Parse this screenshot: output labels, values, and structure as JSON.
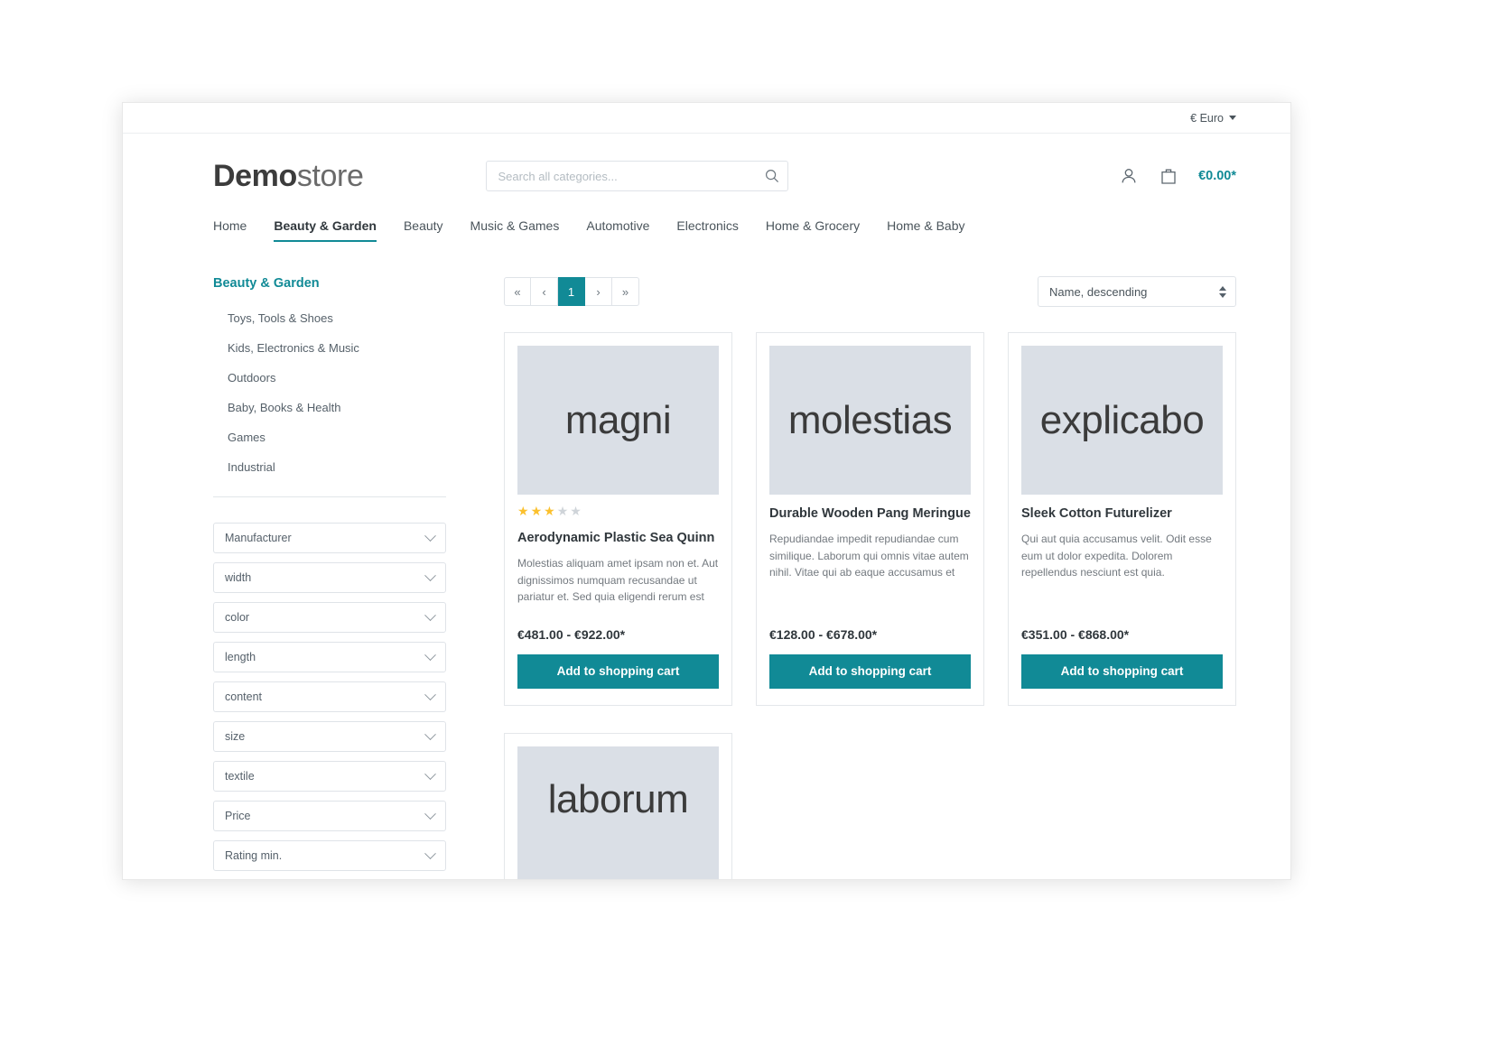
{
  "topbar": {
    "currency": "€ Euro"
  },
  "header": {
    "logo_bold": "Demo",
    "logo_light": "store",
    "search_placeholder": "Search all categories...",
    "search_value": "",
    "cart_total": "€0.00*"
  },
  "nav": {
    "items": [
      {
        "label": "Home",
        "active": false
      },
      {
        "label": "Beauty & Garden",
        "active": true
      },
      {
        "label": "Beauty",
        "active": false
      },
      {
        "label": "Music & Games",
        "active": false
      },
      {
        "label": "Automotive",
        "active": false
      },
      {
        "label": "Electronics",
        "active": false
      },
      {
        "label": "Home & Grocery",
        "active": false
      },
      {
        "label": "Home & Baby",
        "active": false
      }
    ]
  },
  "sidebar": {
    "title": "Beauty & Garden",
    "categories": [
      "Toys, Tools & Shoes",
      "Kids, Electronics & Music",
      "Outdoors",
      "Baby, Books & Health",
      "Games",
      "Industrial"
    ],
    "filters": [
      "Manufacturer",
      "width",
      "color",
      "length",
      "content",
      "size",
      "textile",
      "Price",
      "Rating min."
    ]
  },
  "toolbar": {
    "pagination": [
      {
        "label": "«",
        "name": "first",
        "active": false
      },
      {
        "label": "‹",
        "name": "prev",
        "active": false
      },
      {
        "label": "1",
        "name": "page-1",
        "active": true
      },
      {
        "label": "›",
        "name": "next",
        "active": false
      },
      {
        "label": "»",
        "name": "last",
        "active": false
      }
    ],
    "sort_value": "Name, descending"
  },
  "products": [
    {
      "image_text": "magni",
      "rating": 3,
      "rating_max": 5,
      "title": "Aerodynamic Plastic Sea Quinn",
      "description": "Molestias aliquam amet ipsam non et. Aut dignissimos numquam recusandae ut pariatur et. Sed quia eligendi rerum est",
      "price": "€481.00 - €922.00*",
      "cart_label": "Add to shopping cart"
    },
    {
      "image_text": "molestias",
      "rating": 0,
      "rating_max": 5,
      "title": "Durable Wooden Pang Meringue",
      "description": "Repudiandae impedit repudiandae cum similique. Laborum qui omnis vitae autem nihil. Vitae qui ab eaque accusamus et",
      "price": "€128.00 - €678.00*",
      "cart_label": "Add to shopping cart"
    },
    {
      "image_text": "explicabo",
      "rating": 0,
      "rating_max": 5,
      "title": "Sleek Cotton Futurelizer",
      "description": "Qui aut quia accusamus velit. Odit esse eum ut dolor expedita. Dolorem repellendus nesciunt est quia.",
      "price": "€351.00 - €868.00*",
      "cart_label": "Add to shopping cart"
    },
    {
      "image_text": "laborum",
      "rating": 0,
      "rating_max": 5,
      "title": "",
      "description": "",
      "price": "",
      "cart_label": ""
    }
  ],
  "colors": {
    "accent": "#118a96",
    "star": "#fbc02d",
    "star_off": "#cfd4d9",
    "placeholder_bg": "#dadfe6"
  }
}
